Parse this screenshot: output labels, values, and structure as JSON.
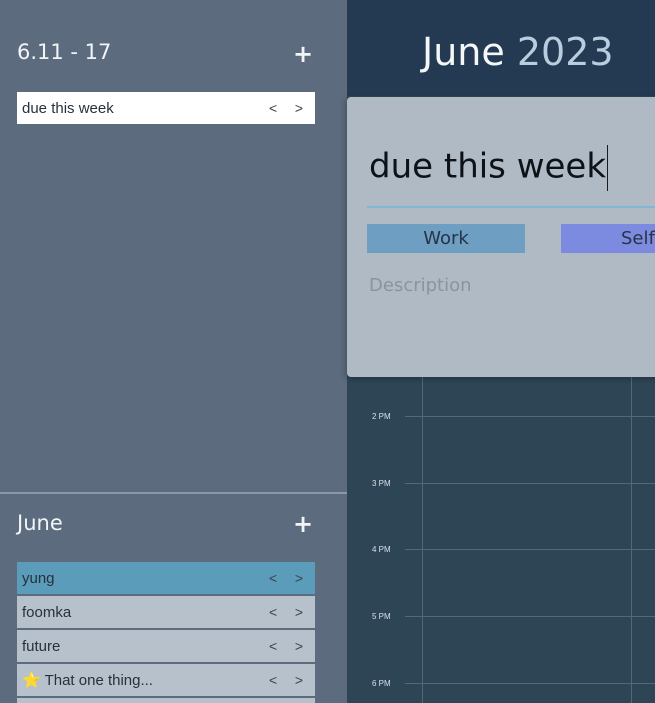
{
  "week_section": {
    "title": "6.11 - 17",
    "add_label": "+",
    "items": [
      {
        "label": "due this week",
        "prev": "<",
        "next": ">",
        "color": "#ffffff"
      }
    ]
  },
  "month_section": {
    "title": "June",
    "add_label": "+",
    "items": [
      {
        "label": "yung",
        "prev": "<",
        "next": ">",
        "color": "#5b9cbb"
      },
      {
        "label": "foomka",
        "prev": "<",
        "next": ">",
        "color": "#b7c1cc"
      },
      {
        "label": "future",
        "prev": "<",
        "next": ">",
        "color": "#b7c1cc"
      },
      {
        "label": "⭐ That one thing...",
        "prev": "<",
        "next": ">",
        "color": "#b7c1cc"
      }
    ]
  },
  "calendar": {
    "month": "June",
    "year": "2023",
    "hours": [
      "2 PM",
      "3 PM",
      "4 PM",
      "5 PM",
      "6 PM"
    ]
  },
  "popup": {
    "title_value": "due this week",
    "tags": [
      "Work",
      "Self"
    ],
    "description_placeholder": "Description"
  }
}
